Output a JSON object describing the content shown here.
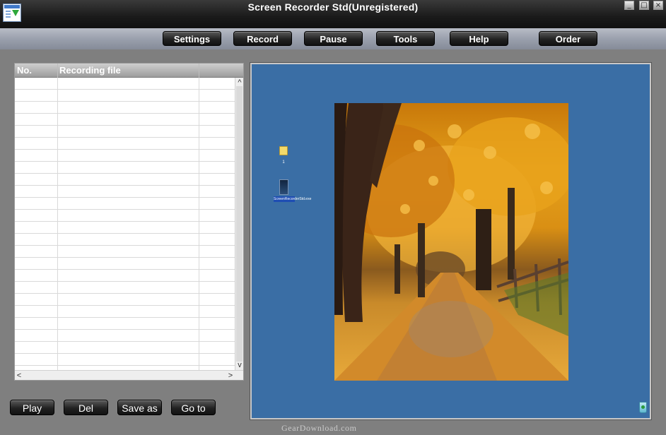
{
  "window": {
    "title": "Screen Recorder Std(Unregistered)",
    "app_icon": "screen-recorder-icon",
    "controls": [
      {
        "name": "minimize-button",
        "glyph": "_"
      },
      {
        "name": "maximize-button",
        "glyph": "□"
      },
      {
        "name": "close-button",
        "glyph": "×"
      }
    ]
  },
  "toolbar": {
    "settings_label": "Settings",
    "record_label": "Record",
    "pause_label": "Pause",
    "tools_label": "Tools",
    "help_label": "Help",
    "order_label": "Order"
  },
  "file_list": {
    "columns": [
      "No.",
      "Recording file",
      ""
    ],
    "rows": [],
    "scroll_up": "^",
    "scroll_down": "v",
    "scroll_left": "<",
    "scroll_right": ">"
  },
  "actions": {
    "play_label": "Play",
    "del_label": "Del",
    "save_as_label": "Save as",
    "go_to_label": "Go to"
  },
  "preview": {
    "desktop_color": "#3a6ea5",
    "folder_label": "1",
    "exe_label": "ScreenRecorderStd.exe",
    "icons": [
      "folder-icon",
      "exe-icon",
      "recycle-bin-icon"
    ],
    "wallpaper": "autumn-trees-path-photo"
  },
  "watermark": "GearDownload.com",
  "colors": {
    "titlebar": "#1a1a1a",
    "toolbar": "#9aa0ad",
    "button": "#222222",
    "background": "#7f7f7f"
  }
}
